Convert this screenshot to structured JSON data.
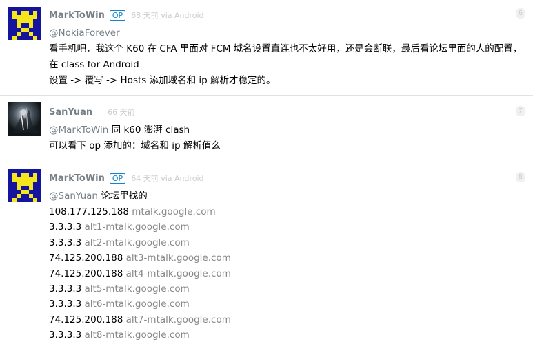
{
  "replies": [
    {
      "author": "MarkToWin",
      "op": "OP",
      "time": "68 天前",
      "via_text": "via Android",
      "floor": "6",
      "mention": "@NokiaForever",
      "line1": "看手机吧，我这个 K60 在 CFA 里面对 FCM 域名设置直连也不太好用，还是会断联，最后看论坛里面的人的配置，在 class for Android",
      "line2": "设置 -> 覆写 -> Hosts 添加域名和 ip 解析才稳定的。"
    },
    {
      "author": "SanYuan",
      "time": "66 天前",
      "floor": "7",
      "mention": "@MarkToWin",
      "line1_rest": " 同 k60 澎湃 clash",
      "line2": "可以看下 op 添加的：域名和 ip 解析值么"
    },
    {
      "author": "MarkToWin",
      "op": "OP",
      "time": "64 天前",
      "via_text": "via Android",
      "floor": "8",
      "mention": "@SanYuan",
      "line1_rest": " 论坛里找的",
      "hosts": [
        {
          "ip": "108.177.125.188",
          "domain": "mtalk.google.com"
        },
        {
          "ip": "3.3.3.3",
          "domain": "alt1-mtalk.google.com"
        },
        {
          "ip": "3.3.3.3",
          "domain": "alt2-mtalk.google.com"
        },
        {
          "ip": "74.125.200.188",
          "domain": "alt3-mtalk.google.com"
        },
        {
          "ip": "74.125.200.188",
          "domain": "alt4-mtalk.google.com"
        },
        {
          "ip": "3.3.3.3",
          "domain": "alt5-mtalk.google.com"
        },
        {
          "ip": "3.3.3.3",
          "domain": "alt6-mtalk.google.com"
        },
        {
          "ip": "74.125.200.188",
          "domain": "alt7-mtalk.google.com"
        },
        {
          "ip": "3.3.3.3",
          "domain": "alt8-mtalk.google.com"
        }
      ]
    }
  ],
  "colors": {
    "author": "#778087",
    "op_badge": "#1484cd",
    "meta": "#cccccc",
    "divider": "#e2e2e2",
    "avatar_mark_blue": "#14149e",
    "avatar_mark_yellow": "#f5e61e"
  },
  "icons": {
    "avatar_1": "pixel-avatar-icon",
    "avatar_2": "photo-avatar-icon",
    "avatar_3": "pixel-avatar-icon"
  }
}
